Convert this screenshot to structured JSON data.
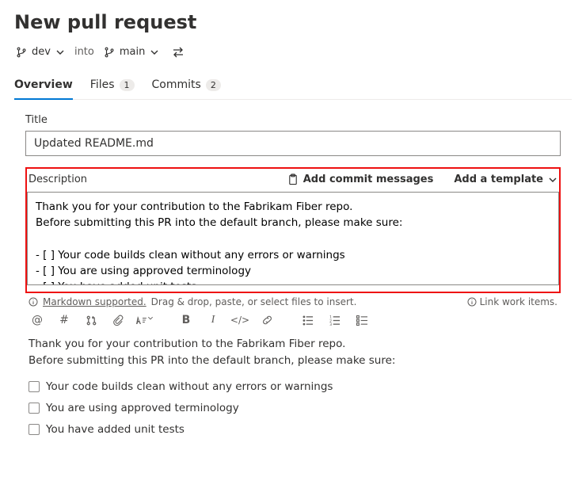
{
  "header": {
    "title": "New pull request"
  },
  "branches": {
    "source_name": "dev",
    "into_label": "into",
    "target_name": "main"
  },
  "tabs": {
    "overview": "Overview",
    "files": "Files",
    "files_count": "1",
    "commits": "Commits",
    "commits_count": "2"
  },
  "form": {
    "title_label": "Title",
    "title_value": "Updated README.md",
    "description_label": "Description",
    "add_commit_messages_label": "Add commit messages",
    "add_template_label": "Add a template",
    "description_value": "Thank you for your contribution to the Fabrikam Fiber repo.\nBefore submitting this PR into the default branch, please make sure:\n\n- [ ] Your code builds clean without any errors or warnings\n- [ ] You are using approved terminology\n- [ ] You have added unit tests"
  },
  "helper": {
    "markdown_link": "Markdown supported.",
    "markdown_rest": "Drag & drop, paste, or select files to insert.",
    "link_work_items": "Link work items."
  },
  "preview": {
    "line1": "Thank you for your contribution to the Fabrikam Fiber repo.",
    "line2": "Before submitting this PR into the default branch, please make sure:",
    "items": [
      "Your code builds clean without any errors or warnings",
      "You are using approved terminology",
      "You have added unit tests"
    ]
  }
}
